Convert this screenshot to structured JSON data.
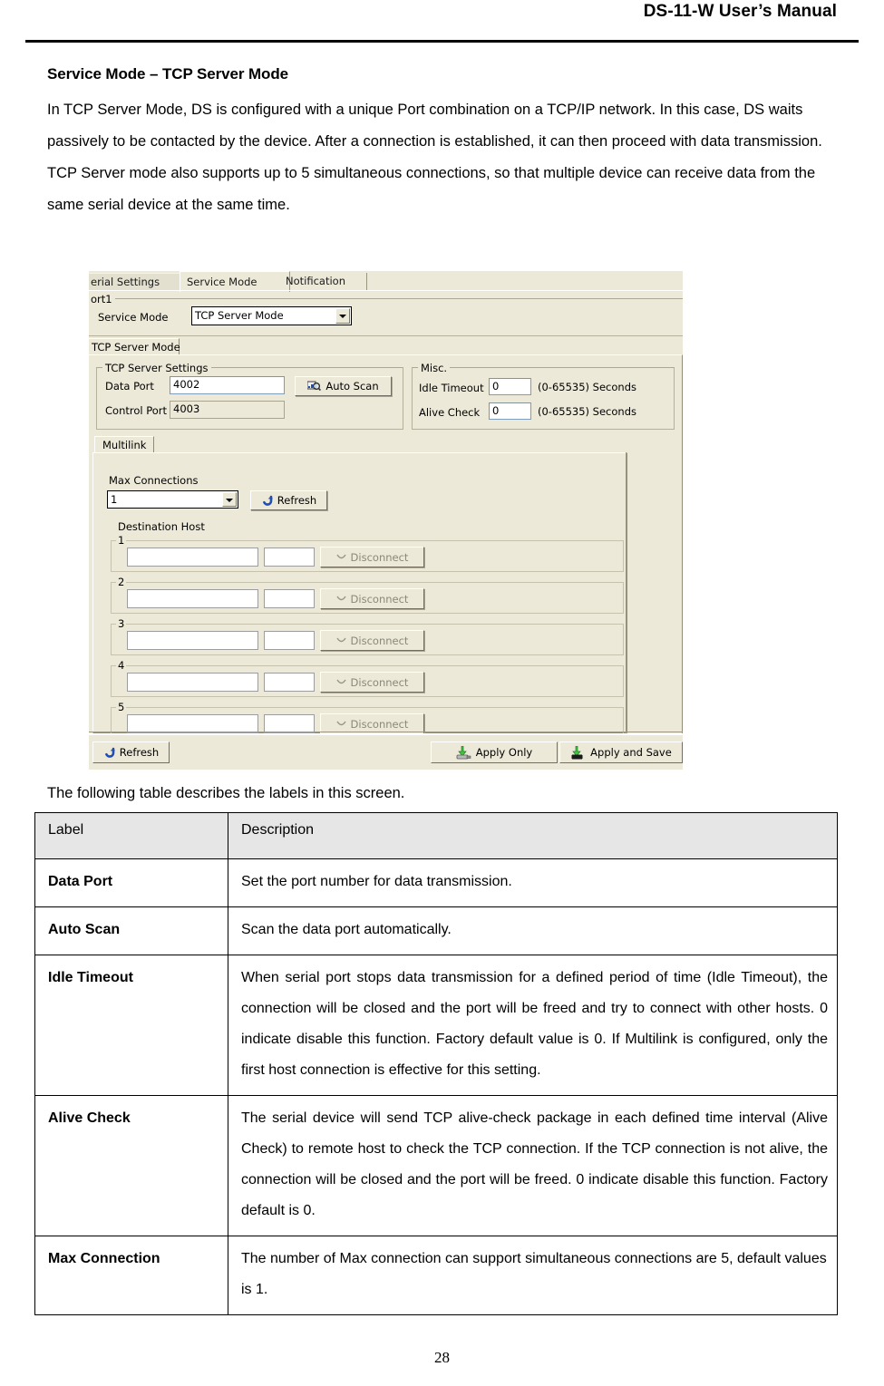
{
  "header": {
    "title": "DS-11-W User’s Manual"
  },
  "page": {
    "number": "28"
  },
  "section": {
    "title": "Service Mode – TCP Server Mode",
    "paragraph": "In TCP Server Mode, DS is configured with a unique Port combination on a TCP/IP network.  In this case, DS waits passively to be contacted by the device.    After a connection is established, it can then proceed with data transmission.    TCP Server mode also supports up to 5 simultaneous connections, so that multiple device can receive data from the same serial device at the same time."
  },
  "caption": "The following table describes the labels in this screen.",
  "screenshot": {
    "tabs": [
      {
        "label": "erial Settings",
        "state": "inactive"
      },
      {
        "label": "Service Mode",
        "state": "active"
      },
      {
        "label": "Notification",
        "state": "plain"
      }
    ],
    "port_group": {
      "label": "ort1"
    },
    "service_mode": {
      "label": "Service Mode",
      "value": "TCP Server Mode",
      "arrow_icon": "chevron-down-icon"
    },
    "mode_subtab": {
      "label": "TCP Server Mode"
    },
    "tcp_server_settings": {
      "group_label": "TCP Server Settings",
      "data_port": {
        "label": "Data Port",
        "value": "4002"
      },
      "control_port": {
        "label": "Control Port",
        "value": "4003"
      },
      "auto_scan": {
        "label": "Auto Scan",
        "icon": "magnifier-scan-icon"
      }
    },
    "misc": {
      "group_label": "Misc.",
      "idle_timeout": {
        "label": "Idle Timeout",
        "value": "0",
        "range": "(0-65535) Seconds"
      },
      "alive_check": {
        "label": "Alive Check",
        "value": "0",
        "range": "(0-65535) Seconds"
      }
    },
    "multilink": {
      "tab_label": "Multilink",
      "max_connections": {
        "label": "Max Connections",
        "value": "1",
        "arrow_icon": "chevron-down-icon"
      },
      "refresh": {
        "label": "Refresh",
        "icon": "refresh-icon"
      },
      "destination_host_label": "Destination Host",
      "hosts": [
        {
          "num": "1",
          "host": "",
          "port": "",
          "disconnect": "Disconnect"
        },
        {
          "num": "2",
          "host": "",
          "port": "",
          "disconnect": "Disconnect"
        },
        {
          "num": "3",
          "host": "",
          "port": "",
          "disconnect": "Disconnect"
        },
        {
          "num": "4",
          "host": "",
          "port": "",
          "disconnect": "Disconnect"
        },
        {
          "num": "5",
          "host": "",
          "port": "",
          "disconnect": "Disconnect"
        }
      ]
    },
    "bottom_bar": {
      "refresh": {
        "label": "Refresh",
        "icon": "refresh-icon"
      },
      "apply_only": {
        "label": "Apply Only",
        "icon": "apply-only-icon"
      },
      "apply_and_save": {
        "label": "Apply and Save",
        "icon": "apply-and-save-icon"
      }
    }
  },
  "table": {
    "headers": {
      "label": "Label",
      "description": "Description"
    },
    "rows": [
      {
        "label": "Data Port",
        "description": "Set the port number for data transmission."
      },
      {
        "label": "Auto Scan",
        "description": "Scan the data port automatically."
      },
      {
        "label": "Idle Timeout",
        "description": "When serial port stops data transmission for a defined period of time (Idle Timeout), the connection will be closed and the port will be freed and try to connect with other hosts.   0 indicate disable this function.  Factory default value is 0.   If Multilink is configured, only the first host connection is effective for this setting."
      },
      {
        "label": "Alive Check",
        "description": "The serial device will send TCP alive-check package in each defined time interval (Alive Check) to remote host to check the TCP connection.   If the TCP connection is not alive, the connection will be closed and the port will be freed.  0 indicate disable this function.  Factory default is 0."
      },
      {
        "label": "Max Connection",
        "description": "The number of Max connection can support simultaneous connections are 5, default values is 1."
      }
    ]
  },
  "colors": {
    "window_face": "#ece9d8",
    "table_header": "#e6e6e6",
    "refresh_blue": "#1f4fb5",
    "apply_green": "#3fc83f"
  }
}
